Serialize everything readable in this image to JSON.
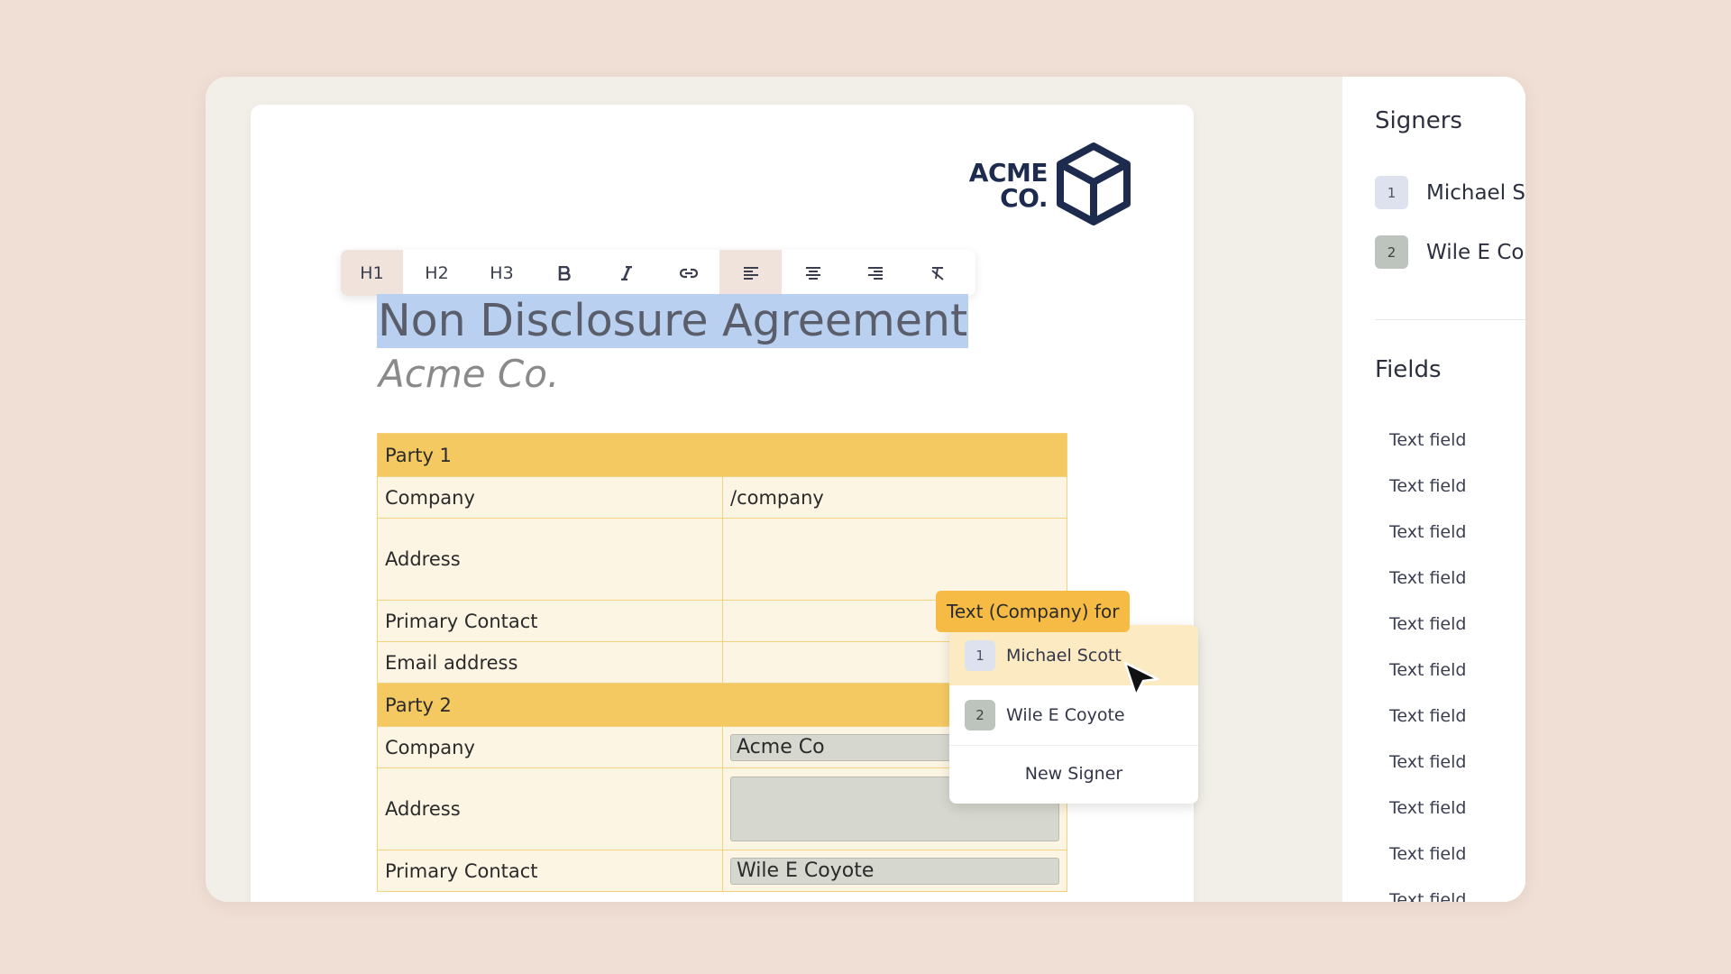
{
  "logo": {
    "line1": "ACME",
    "line2": "CO."
  },
  "toolbar": {
    "h1": "H1",
    "h2": "H2",
    "h3": "H3",
    "bold": "bold-icon",
    "italic": "italic-icon",
    "link": "link-icon",
    "align_left": "align-left-icon",
    "align_center": "align-center-icon",
    "align_right": "align-right-icon",
    "clear_format": "clear-format-icon",
    "active": [
      "H1",
      "align-left"
    ]
  },
  "document": {
    "title": "Non Disclosure Agreement",
    "subtitle": "Acme Co.",
    "party1": {
      "header": "Party 1",
      "company_label": "Company",
      "company_value": "/company",
      "address_label": "Address",
      "contact_label": "Primary Contact",
      "email_label": "Email address"
    },
    "party2": {
      "header": "Party 2",
      "company_label": "Company",
      "company_value": "Acme Co",
      "address_label": "Address",
      "contact_label": "Primary Contact",
      "contact_value": "Wile E Coyote"
    }
  },
  "popup": {
    "tag": "Text (Company) for",
    "items": [
      {
        "num": "1",
        "name": "Michael Scott"
      },
      {
        "num": "2",
        "name": "Wile E Coyote"
      }
    ],
    "new_signer": "New Signer"
  },
  "sidebar": {
    "signers_heading": "Signers",
    "signers": [
      {
        "num": "1",
        "name": "Michael S"
      },
      {
        "num": "2",
        "name": "Wile E Co"
      }
    ],
    "fields_heading": "Fields",
    "fields": [
      "Text field",
      "Text field",
      "Text field",
      "Text field",
      "Text field",
      "Text field",
      "Text field",
      "Text field",
      "Text field",
      "Text field",
      "Text field"
    ]
  },
  "colors": {
    "background": "#f0dfd5",
    "section_header": "#f5c962",
    "title_highlight": "#b9d0f0",
    "tag": "#f5bb45",
    "logo": "#1d2b4f"
  }
}
